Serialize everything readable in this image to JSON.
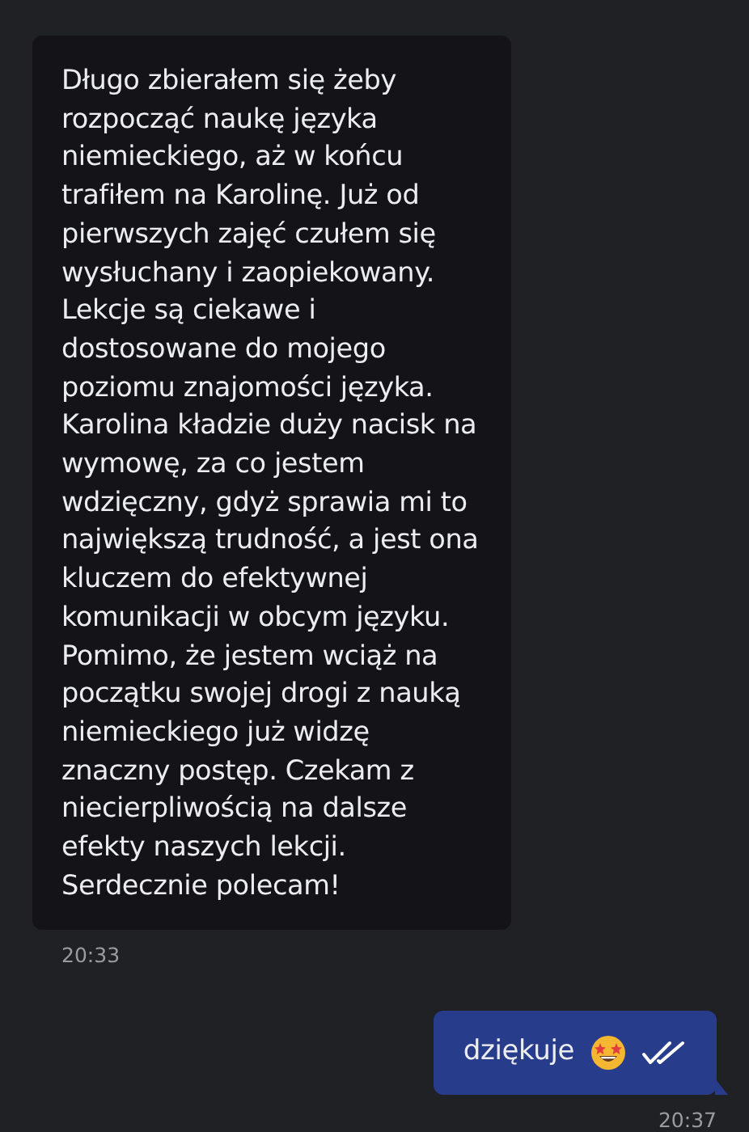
{
  "messages": [
    {
      "outgoing": false,
      "text": "Długo zbierałem się żeby rozpocząć naukę języka niemieckiego, aż w końcu trafiłem na Karolinę. Już od pierwszych zajęć czułem się wysłuchany i zaopiekowany. Lekcje są ciekawe i dostosowane do mojego poziomu znajomości języka. Karolina kładzie duży nacisk na wymowę, za co jestem wdzięczny, gdyż sprawia mi to największą trudność, a jest ona kluczem do efektywnej komunikacji w obcym języku. Pomimo, że jestem wciąż na początku swojej drogi z nauką niemieckiego już widzę znaczny postęp. Czekam z niecierpliwością na dalsze efekty naszych lekcji. Serdecznie polecam!",
      "time": "20:33"
    },
    {
      "outgoing": true,
      "text": "dziękuje",
      "emoji": true,
      "read": true,
      "time": "20:37"
    }
  ]
}
